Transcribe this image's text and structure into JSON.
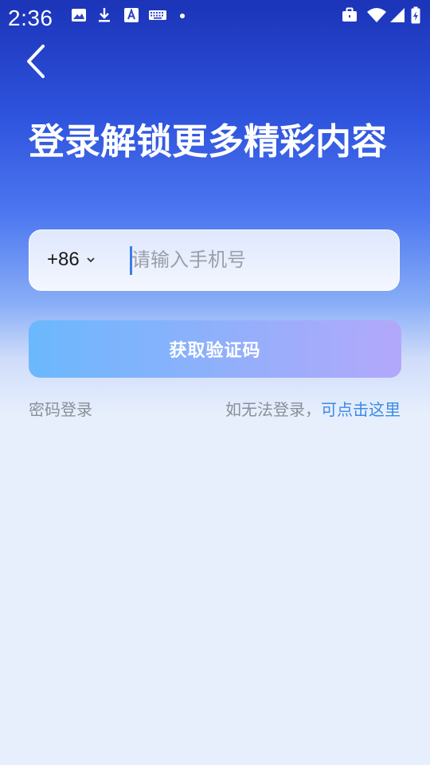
{
  "status_bar": {
    "time": "2:36",
    "left_icons": [
      "image-icon",
      "download-icon",
      "text-a-icon",
      "keyboard-icon",
      "dot-icon"
    ],
    "right_icons": [
      "briefcase-icon",
      "wifi-icon",
      "cell-signal-icon",
      "battery-icon"
    ]
  },
  "header": {
    "back_icon": "chevron-left-icon",
    "headline": "登录解锁更多精彩内容"
  },
  "phone_form": {
    "country_code": "+86",
    "phone_value": "",
    "phone_placeholder": "请输入手机号"
  },
  "actions": {
    "get_code_label": "获取验证码",
    "password_login_label": "密码登录",
    "help_prefix": "如无法登录，",
    "help_link": "可点击这里"
  },
  "colors": {
    "gradient_top": "#1b34b8",
    "page_background": "#e7effd",
    "button_start": "#6bb8fd",
    "button_end": "#b3a8fb",
    "link": "#3b8ae6",
    "muted_text": "#8a8f99"
  }
}
